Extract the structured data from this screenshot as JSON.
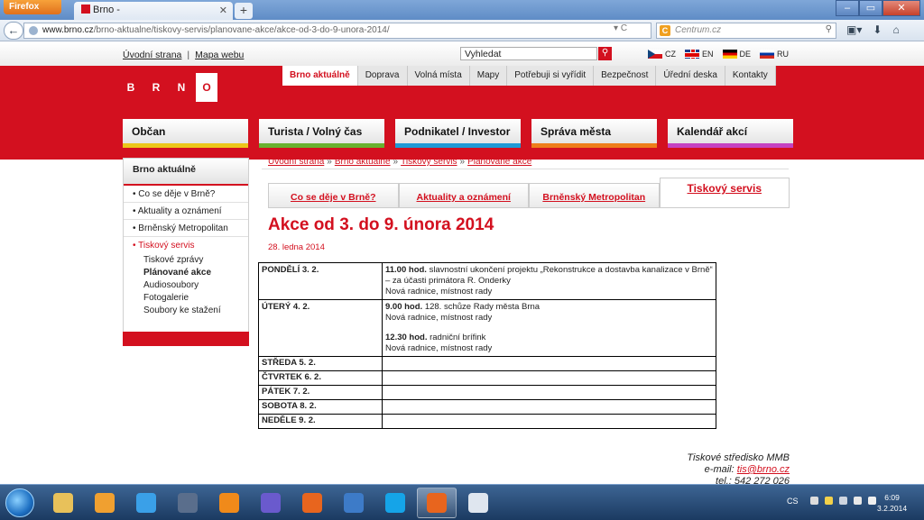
{
  "browser": {
    "app_button": "Firefox",
    "tab_title": "Brno -",
    "new_tab": "+",
    "url_domain": "www.brno.cz",
    "url_path": "/brno-aktualne/tiskovy-servis/planovane-akce/akce-od-3-do-9-unora-2014/",
    "search_placeholder": "Centrum.cz",
    "window_buttons": [
      "–",
      "▭",
      "✕"
    ]
  },
  "site": {
    "top_links": [
      "Úvodní strana",
      "Mapa webu"
    ],
    "search_value": "Vyhledat",
    "languages": [
      {
        "code": "CZ",
        "flag": "cz"
      },
      {
        "code": "EN",
        "flag": "en"
      },
      {
        "code": "DE",
        "flag": "de"
      },
      {
        "code": "RU",
        "flag": "ru"
      }
    ],
    "logo_letters": [
      "B",
      "R",
      "N",
      "O"
    ],
    "sub_nav": [
      "Brno aktuálně",
      "Doprava",
      "Volná místa",
      "Mapy",
      "Potřebuji si vyřídit",
      "Bezpečnost",
      "Úřední deska",
      "Kontakty"
    ],
    "sub_nav_active": "Brno aktuálně",
    "main_nav": [
      "Občan",
      "Turista / Volný čas",
      "Podnikatel / Investor",
      "Správa města",
      "Kalendář akcí"
    ],
    "main_nav_colors": [
      "#ecc61a",
      "#69b12f",
      "#1f9ad6",
      "#ee7d1a",
      "#c542c1"
    ],
    "brand_color": "#d3101f"
  },
  "sidebar": {
    "title": "Brno aktuálně",
    "items": [
      "Co se děje v Brně?",
      "Aktuality a oznámení",
      "Brněnský Metropolitan",
      "Tiskový servis"
    ],
    "subitems": [
      "Tiskové zprávy",
      "Plánované akce",
      "Audiosoubory",
      "Fotogalerie",
      "Soubory ke stažení"
    ]
  },
  "content": {
    "breadcrumb": [
      "Úvodní strana",
      "Brno aktuálně",
      "Tiskový servis",
      "Plánované akce"
    ],
    "tabs": [
      "Co se děje v Brně?",
      "Aktuality a oznámení",
      "Brněnský Metropolitan",
      "Tiskový servis"
    ],
    "active_tab": "Tiskový servis",
    "title": "Akce od 3. do 9. února 2014",
    "date": "28. ledna 2014",
    "schedule": [
      {
        "day": "PONDĚLÍ 3. 2.",
        "events": [
          {
            "time": "11.00 hod.",
            "text": "slavnostní ukončení projektu „Rekonstrukce a dostavba kanalizace v Brně“ – za účasti primátora R. Onderky",
            "place": "Nová radnice, místnost rady"
          }
        ]
      },
      {
        "day": "ÚTERÝ 4. 2.",
        "events": [
          {
            "time": "9.00 hod.",
            "text": "128. schůze Rady města Brna",
            "place": "Nová radnice, místnost rady"
          },
          {
            "time": "12.30 hod.",
            "text": "radniční brífink",
            "place": "Nová radnice, místnost rady"
          }
        ]
      },
      {
        "day": "STŘEDA 5. 2.",
        "events": []
      },
      {
        "day": "ČTVRTEK 6. 2.",
        "events": []
      },
      {
        "day": "PÁTEK 7. 2.",
        "events": []
      },
      {
        "day": "SOBOTA 8. 2.",
        "events": []
      },
      {
        "day": "NEDĚLE 9. 2.",
        "events": []
      }
    ],
    "footer": {
      "org": "Tiskové středisko MMB",
      "email_label": "e-mail:",
      "email": "tis@brno.cz",
      "tel_label": "tel.:",
      "tel": "542 272 026"
    }
  },
  "taskbar": {
    "apps": [
      {
        "name": "file-explorer-icon",
        "color": "#e8c15a"
      },
      {
        "name": "media-player-icon",
        "color": "#f0a030"
      },
      {
        "name": "internet-explorer-icon",
        "color": "#3aa0e8"
      },
      {
        "name": "hp-icon",
        "color": "#5a6e8c"
      },
      {
        "name": "vlc-icon",
        "color": "#f08a1a"
      },
      {
        "name": "save-disk-icon",
        "color": "#6a5acd"
      },
      {
        "name": "firefox-icon",
        "color": "#e8651e"
      },
      {
        "name": "thunderbird-icon",
        "color": "#3d7bc8"
      },
      {
        "name": "skype-icon",
        "color": "#15a4e8"
      },
      {
        "name": "firefox-active-icon",
        "color": "#e8651e"
      },
      {
        "name": "pdf-document-icon",
        "color": "#dfe6ef"
      }
    ],
    "active_app": 9,
    "lang": "CS",
    "time": "6:09",
    "date": "3.2.2014"
  }
}
